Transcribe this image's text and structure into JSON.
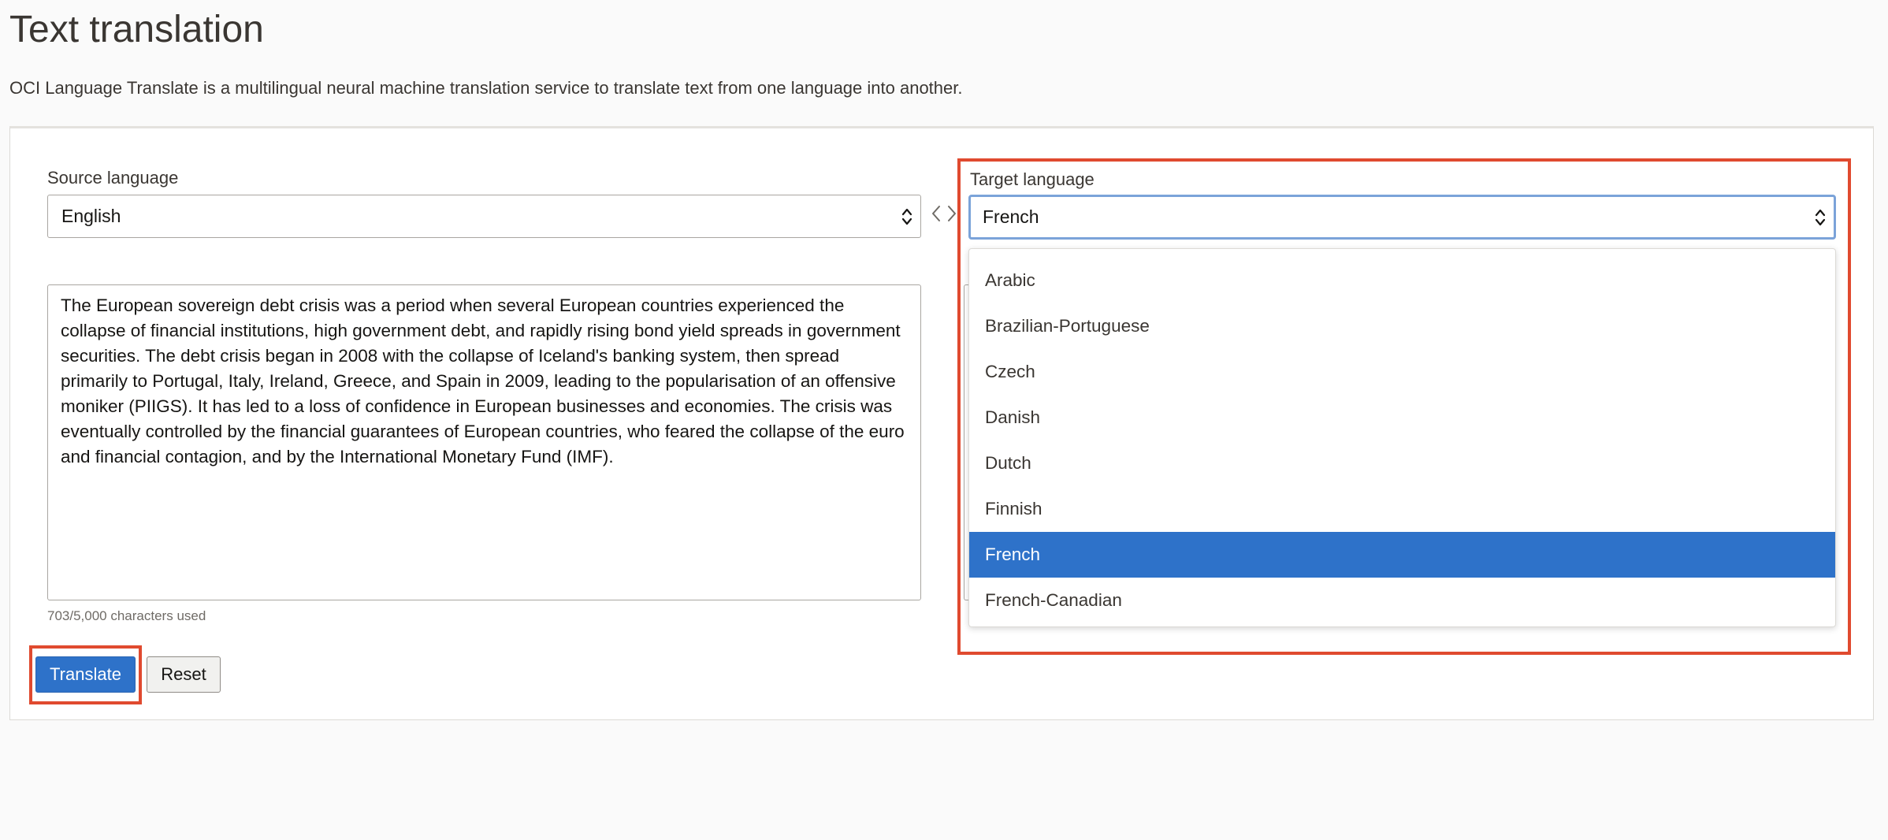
{
  "page": {
    "title": "Text translation",
    "description": "OCI Language Translate is a multilingual neural machine translation service to translate text from one language into another."
  },
  "source": {
    "label": "Source language",
    "selected": "English",
    "text": "The European sovereign debt crisis was a period when several European countries experienced the collapse of financial institutions, high government debt, and rapidly rising bond yield spreads in government securities. The debt crisis began in 2008 with the collapse of Iceland's banking system, then spread primarily to Portugal, Italy, Ireland, Greece, and Spain in 2009, leading to the popularisation of an offensive moniker (PIIGS). It has led to a loss of confidence in European businesses and economies. The crisis was eventually controlled by the financial guarantees of European countries, who feared the collapse of the euro and financial contagion, and by the International Monetary Fund (IMF).",
    "char_count": "703/5,000 characters used"
  },
  "target": {
    "label": "Target language",
    "selected": "French",
    "options": [
      {
        "label": "Arabic",
        "selected": false
      },
      {
        "label": "Brazilian-Portuguese",
        "selected": false
      },
      {
        "label": "Czech",
        "selected": false
      },
      {
        "label": "Danish",
        "selected": false
      },
      {
        "label": "Dutch",
        "selected": false
      },
      {
        "label": "Finnish",
        "selected": false
      },
      {
        "label": "French",
        "selected": true
      },
      {
        "label": "French-Canadian",
        "selected": false
      }
    ]
  },
  "buttons": {
    "translate": "Translate",
    "reset": "Reset"
  },
  "icons": {
    "select_arrows": "chevron-up-down-icon",
    "swap": "swap-languages-icon"
  },
  "colors": {
    "primary": "#2e72c9",
    "highlight": "#e04a2f",
    "focus": "#7ba3d9"
  }
}
